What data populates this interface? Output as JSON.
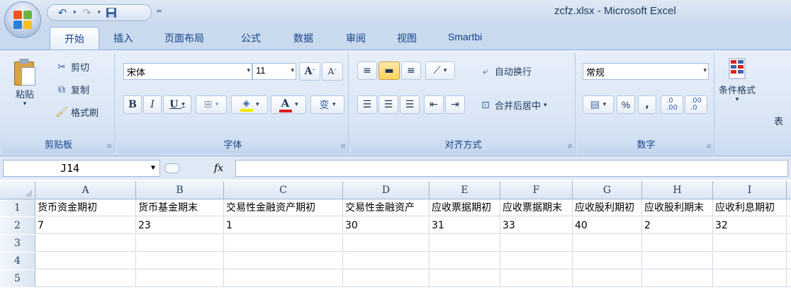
{
  "window": {
    "title": "zcfz.xlsx - Microsoft Excel"
  },
  "tabs": [
    "开始",
    "插入",
    "页面布局",
    "公式",
    "数据",
    "审阅",
    "视图",
    "Smartbi"
  ],
  "clipboard": {
    "paste": "粘贴",
    "cut": "剪切",
    "copy": "复制",
    "format_painter": "格式刷",
    "label": "剪贴板"
  },
  "font": {
    "name": "宋体",
    "size": "11",
    "grow": "A",
    "shrink": "A",
    "bold": "B",
    "italic": "I",
    "underline": "U",
    "font_color": "A",
    "phonetic": "变",
    "label": "字体"
  },
  "alignment": {
    "wrap_text": "自动换行",
    "merge_center": "合并后居中",
    "label": "对齐方式"
  },
  "number": {
    "format": "常规",
    "percent": "%",
    "comma": ",",
    "inc_decimal": ".0\n.00",
    "dec_decimal": ".00\n.0",
    "label": "数字"
  },
  "styles": {
    "conditional": "条件格式",
    "partial": "表"
  },
  "formula_bar": {
    "name_box": "J14",
    "fx": "fx",
    "content": ""
  },
  "sheet": {
    "columns": [
      "A",
      "B",
      "C",
      "D",
      "E",
      "F",
      "G",
      "H",
      "I"
    ],
    "rows": [
      {
        "num": "1",
        "cells": [
          "货币资金期初",
          "货币基金期末",
          "交易性金融资产期初",
          "交易性金融资产",
          "应收票据期初",
          "应收票据期末",
          "应收股利期初",
          "应收股利期末",
          "应收利息期初"
        ]
      },
      {
        "num": "2",
        "cells": [
          "7",
          "23",
          "1",
          "30",
          "31",
          "33",
          "40",
          "2",
          "32"
        ]
      },
      {
        "num": "3",
        "cells": [
          "",
          "",
          "",
          "",
          "",
          "",
          "",
          "",
          ""
        ]
      },
      {
        "num": "4",
        "cells": [
          "",
          "",
          "",
          "",
          "",
          "",
          "",
          "",
          ""
        ]
      },
      {
        "num": "5",
        "cells": [
          "",
          "",
          "",
          "",
          "",
          "",
          "",
          "",
          ""
        ]
      }
    ]
  },
  "colors": {
    "accent": "#15428b",
    "ribbon": "#dbe7f6",
    "highlight": "#ffd35c",
    "font_red": "#e02020",
    "fill_yellow": "#f5e800"
  }
}
